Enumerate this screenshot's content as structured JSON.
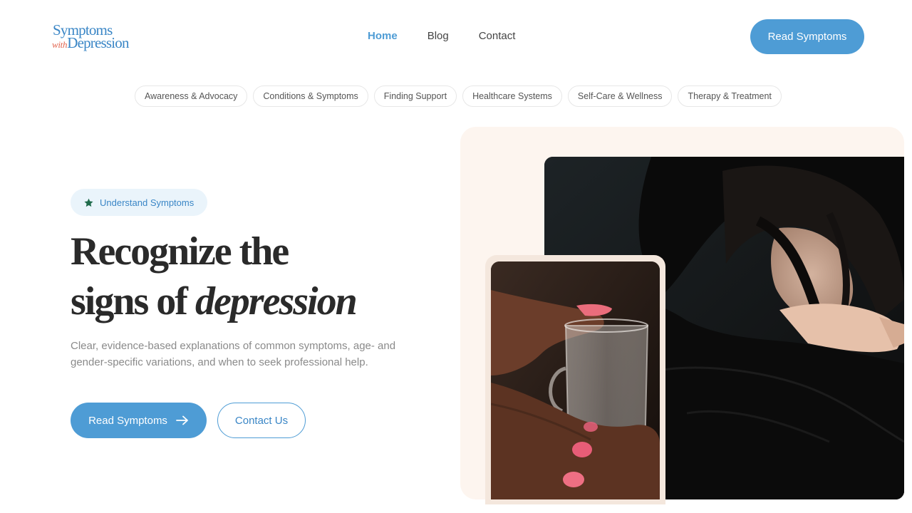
{
  "header": {
    "logo": {
      "line1": "Symptoms",
      "with": "with",
      "line2": "Depression"
    },
    "nav": [
      {
        "label": "Home",
        "active": true
      },
      {
        "label": "Blog",
        "active": false
      },
      {
        "label": "Contact",
        "active": false
      }
    ],
    "cta_label": "Read Symptoms"
  },
  "categories": [
    "Awareness & Advocacy",
    "Conditions & Symptoms",
    "Finding Support",
    "Healthcare Systems",
    "Self-Care & Wellness",
    "Therapy & Treatment"
  ],
  "hero": {
    "badge": {
      "icon": "star-icon",
      "label": "Understand Symptoms"
    },
    "headline_line1": "Recognize the",
    "headline_line2_plain": "signs of ",
    "headline_line2_italic": "depression",
    "subtext": "Clear, evidence-based explanations of common symptoms, age- and gender-specific variations, and when to seek professional help.",
    "primary_button": {
      "label": "Read Symptoms",
      "icon": "arrow-right-icon"
    },
    "secondary_button": {
      "label": "Contact Us"
    }
  },
  "colors": {
    "accent": "#4e9cd5",
    "logo_blue": "#3a86c6",
    "logo_red": "#e2654f",
    "badge_bg": "#eaf4fb",
    "star_green": "#1f6b4b",
    "panel_bg": "#fdf5ef"
  }
}
